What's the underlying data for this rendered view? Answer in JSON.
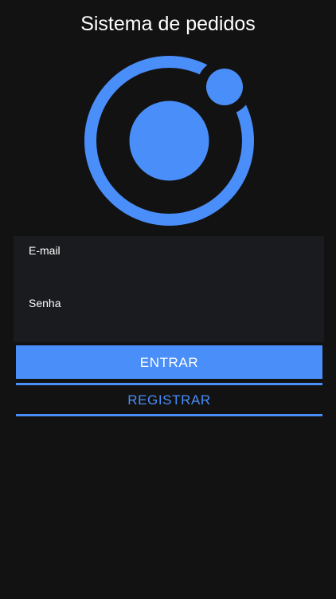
{
  "header": {
    "title": "Sistema de pedidos"
  },
  "logo": {
    "icon": "ionic-logo-icon",
    "color": "#4a8ef9"
  },
  "form": {
    "email_label": "E-mail",
    "email_value": "",
    "password_label": "Senha",
    "password_value": ""
  },
  "actions": {
    "login_label": "ENTRAR",
    "register_label": "REGISTRAR"
  },
  "colors": {
    "background": "#121212",
    "form_background": "#1a1b1e",
    "accent": "#4a8ef9",
    "text": "#ffffff"
  }
}
